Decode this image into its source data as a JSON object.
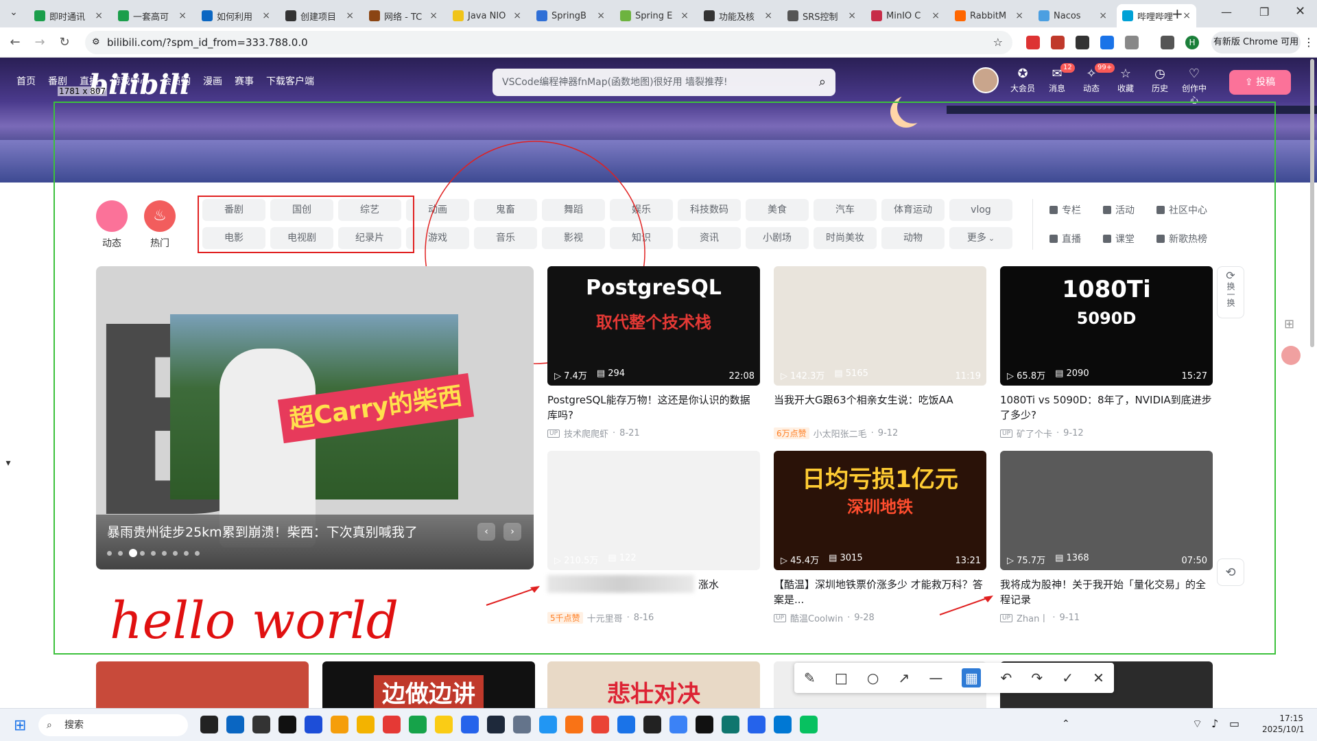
{
  "browser": {
    "tabs": [
      {
        "label": "即时通讯",
        "color": "#1b9e4b"
      },
      {
        "label": "一套高可",
        "color": "#1b9e4b"
      },
      {
        "label": "如何利用",
        "color": "#0a66c2"
      },
      {
        "label": "创建项目",
        "color": "#333333"
      },
      {
        "label": "网络 - TC",
        "color": "#8b4513"
      },
      {
        "label": "Java NIO",
        "color": "#f0c419"
      },
      {
        "label": "SpringB",
        "color": "#2f6fd6"
      },
      {
        "label": "Spring E",
        "color": "#6db33f"
      },
      {
        "label": "功能及核",
        "color": "#333333"
      },
      {
        "label": "SRS控制",
        "color": "#555555"
      },
      {
        "label": "MinIO C",
        "color": "#c72c48"
      },
      {
        "label": "RabbitM",
        "color": "#ff6600"
      },
      {
        "label": "Nacos",
        "color": "#4b9fe1"
      },
      {
        "label": "哔哩哔哩",
        "color": "#00a1d6"
      }
    ],
    "new_tab_icon": "plus-icon",
    "url": "bilibili.com/?spm_id_from=333.788.0.0",
    "chrome_notice": "有新版 Chrome 可用",
    "profile_initial": "H"
  },
  "header": {
    "left_nav": [
      "首页",
      "番剧",
      "直播",
      "游戏中心",
      "会员购",
      "漫画",
      "赛事",
      "下载客户端"
    ],
    "search_placeholder": "VSCode编程神器fnMap(函数地图)很好用 墙裂推荐!",
    "right_nav": [
      {
        "label": "大会员",
        "icon": "vip-icon",
        "badge": ""
      },
      {
        "label": "消息",
        "icon": "message-icon",
        "badge": "12"
      },
      {
        "label": "动态",
        "icon": "dynamic-icon",
        "badge": "99+"
      },
      {
        "label": "收藏",
        "icon": "star-icon",
        "badge": ""
      },
      {
        "label": "历史",
        "icon": "history-icon",
        "badge": ""
      },
      {
        "label": "创作中心",
        "icon": "creator-icon",
        "badge": ""
      }
    ],
    "upload_label": "投稿",
    "logo": "bilibili"
  },
  "screenshot_overlay": {
    "size_label": "1781 x 807"
  },
  "channels": {
    "dynamic_label": "动态",
    "hot_label": "热门",
    "row1": [
      "番剧",
      "国创",
      "综艺",
      "动画",
      "鬼畜",
      "舞蹈",
      "娱乐",
      "科技数码",
      "美食",
      "汽车",
      "体育运动",
      "vlog"
    ],
    "row2": [
      "电影",
      "电视剧",
      "纪录片",
      "游戏",
      "音乐",
      "影视",
      "知识",
      "资讯",
      "小剧场",
      "时尚美妆",
      "动物",
      "更多"
    ],
    "side_links": [
      "专栏",
      "活动",
      "社区中心",
      "直播",
      "课堂",
      "新歌热榜"
    ]
  },
  "carousel": {
    "title": "暴雨贵州徒步25km累到崩溃！柴西：下次真别喊我了",
    "promo_text": "超Carry的柴西",
    "slide_count": 9,
    "active_index": 2
  },
  "videos": [
    {
      "thumb_text": "PostgreSQL",
      "thumb_sub": "取代整个技术栈",
      "views": "7.4万",
      "danmaku": "294",
      "duration": "22:08",
      "title": "PostgreSQL能存万物！这还是你认识的数据库吗?",
      "badge": "",
      "author": "技术爬爬虾",
      "date": "8-21",
      "bg": "#111111"
    },
    {
      "thumb_text": "",
      "thumb_sub": "",
      "views": "142.3万",
      "danmaku": "5165",
      "duration": "11:19",
      "title": "当我开大G跟63个相亲女生说：吃饭AA",
      "badge": "6万点赞",
      "author": "小太阳张二毛",
      "date": "9-12",
      "bg": "#e9e4dc"
    },
    {
      "thumb_text": "1080Ti",
      "thumb_sub": "5090D",
      "views": "65.8万",
      "danmaku": "2090",
      "duration": "15:27",
      "title": "1080Ti vs 5090D：8年了，NVIDIA到底进步了多少?",
      "badge": "",
      "author": "矿了个卡",
      "date": "9-12",
      "bg": "#0a0a0a"
    },
    {
      "thumb_text": "",
      "thumb_sub": "",
      "views": "210.5万",
      "danmaku": "122",
      "duration": "",
      "title": "涨水",
      "badge": "5千点赞",
      "author": "十元里哥",
      "date": "8-16",
      "bg": "#f2f2f2"
    },
    {
      "thumb_text": "日均亏损1亿元",
      "thumb_sub": "深圳地铁",
      "views": "45.4万",
      "danmaku": "3015",
      "duration": "13:21",
      "title": "【酷温】深圳地铁票价涨多少 才能救万科？答案是...",
      "badge": "",
      "author": "酷温Coolwin",
      "date": "9-28",
      "bg": "#2a1208"
    },
    {
      "thumb_text": "",
      "thumb_sub": "",
      "views": "75.7万",
      "danmaku": "1368",
      "duration": "07:50",
      "title": "我将成为股神！关于我开始「量化交易」的全程记录",
      "badge": "",
      "author": "Zhan丨",
      "date": "9-11",
      "bg": "#5a5a5a"
    }
  ],
  "handwriting": "hello world",
  "side_buttons": [
    {
      "label": "换一换",
      "icon": "refresh-icon"
    }
  ],
  "annotation_tools": [
    "pencil-icon",
    "rectangle-icon",
    "ellipse-icon",
    "arrow-icon",
    "line-icon",
    "mosaic-icon",
    "undo-icon",
    "redo-icon",
    "confirm-icon",
    "close-icon"
  ],
  "bottom_row": [
    {
      "text": "",
      "bg": "#c84a3a"
    },
    {
      "text": "边做边讲",
      "bg": "#111111"
    },
    {
      "text": "悲壮对决",
      "bg": "#e8d9c6"
    },
    {
      "text": "",
      "bg": "#eeeeee"
    },
    {
      "text": "",
      "bg": "#2b2b2b"
    }
  ],
  "taskbar": {
    "search_label": "搜索",
    "time": "17:15",
    "date": "2025/10/1"
  }
}
